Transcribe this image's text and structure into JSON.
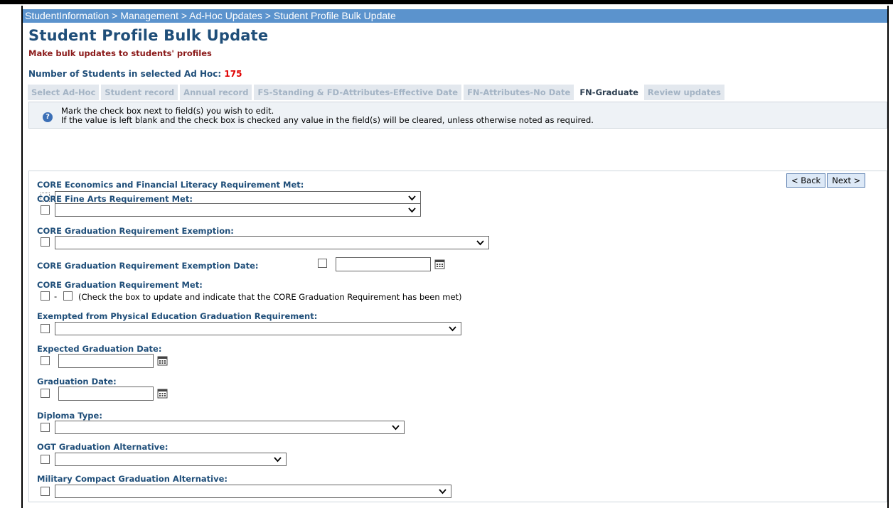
{
  "breadcrumb": "StudentInformation > Management > Ad-Hoc Updates > Student Profile Bulk Update",
  "page": {
    "title": "Student Profile Bulk Update",
    "subtitle": "Make bulk updates to students' profiles",
    "count_label": "Number of Students in selected Ad Hoc: ",
    "count_value": "175"
  },
  "tabs": [
    {
      "label": "Select Ad-Hoc"
    },
    {
      "label": "Student record"
    },
    {
      "label": "Annual record"
    },
    {
      "label": "FS-Standing & FD-Attributes-Effective Date"
    },
    {
      "label": "FN-Attributes-No Date"
    },
    {
      "label": "FN-Graduate",
      "active": true
    },
    {
      "label": "Review updates"
    }
  ],
  "info": {
    "line1": "Mark the check box next to field(s) you wish to edit.",
    "line2": "If the value is left blank and the check box is checked any value in the field(s) will be cleared, unless otherwise noted as required."
  },
  "nav": {
    "back": "< Back",
    "next": "Next >"
  },
  "fields": {
    "econ": "CORE Economics and Financial Literacy Requirement Met:",
    "finearts": "CORE Fine Arts Requirement Met:",
    "exemption": "CORE Graduation Requirement Exemption:",
    "exemption_date": "CORE Graduation Requirement Exemption Date:",
    "req_met": "CORE Graduation Requirement Met:",
    "req_met_note": "(Check the box to update and indicate that the CORE Graduation Requirement has been met)",
    "pe_exempt": "Exempted from Physical Education Graduation Requirement:",
    "expected_grad": "Expected Graduation Date:",
    "grad_date": "Graduation Date:",
    "diploma": "Diploma Type:",
    "ogt": "OGT Graduation Alternative:",
    "military": "Military Compact Graduation Alternative:"
  },
  "icons": {
    "info": "info-icon",
    "calendar": "calendar-icon",
    "dropdown": "chevron-down-icon"
  }
}
